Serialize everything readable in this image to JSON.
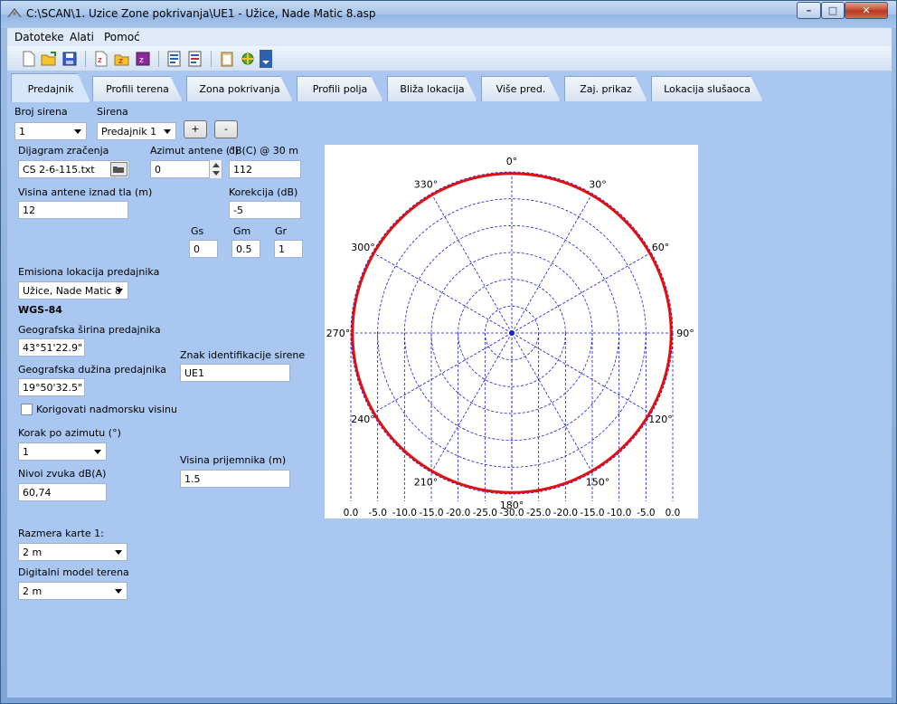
{
  "window": {
    "title": "C:\\SCAN\\1. Uzice Zone pokrivanja\\UE1 - Užice, Nade Matic 8.asp",
    "min_label": "–",
    "max_label": "□",
    "close_label": "✕"
  },
  "menu": [
    "Datoteke",
    "Alati",
    "Pomoć"
  ],
  "toolbar": {
    "icons": [
      "new-icon",
      "open-icon",
      "save-icon",
      "new-z-icon",
      "open-z-icon",
      "save-z-icon",
      "word-icon",
      "word-export-icon",
      "clipboard-icon",
      "tools-icon",
      "more-icon"
    ]
  },
  "tabs": [
    "Predajnik",
    "Profili terena",
    "Zona pokrivanja",
    "Profili polja",
    "Bliža lokacija",
    "Više pred.",
    "Zaj. prikaz",
    "Lokacija slušaoca"
  ],
  "form": {
    "broj_sirena_label": "Broj sirena",
    "broj_sirena_value": "1",
    "sirena_label": "Sirena",
    "sirena_value": "Predajnik 1",
    "plus_label": "+",
    "minus_label": "-",
    "dijagram_label": "Dijagram zračenja",
    "dijagram_value": "CS 2-6-115.txt",
    "azimut_label": "Azimut antene (°)",
    "azimut_value": "0",
    "db_label": "dB(C) @ 30 m",
    "db_value": "112",
    "visina_antene_label": "Visina antene iznad tla (m)",
    "visina_antene_value": "12",
    "korekcija_label": "Korekcija (dB)",
    "korekcija_value": "-5",
    "gs_label": "Gs",
    "gs_value": "0",
    "gm_label": "Gm",
    "gm_value": "0.5",
    "gr_label": "Gr",
    "gr_value": "1",
    "emisiona_label": "Emisiona lokacija predajnika",
    "emisiona_value": "Užice, Nade Matic 8",
    "wgs_label": "WGS-84",
    "sirina_label": "Geografska širina predajnika",
    "sirina_value": "43°51'22.9\"",
    "duzina_label": "Geografska dužina predajnika",
    "duzina_value": "19°50'32.5\"",
    "znak_label": "Znak identifikacije sirene",
    "znak_value": "UE1",
    "korigovati_label": "Korigovati nadmorsku visinu",
    "korak_label": "Korak po azimutu (°)",
    "korak_value": "1",
    "nivoi_label": "Nivoi zvuka dB(A)",
    "nivoi_value": "60,74",
    "visina_prijemnika_label": "Visina prijemnika (m)",
    "visina_prijemnika_value": "1.5",
    "razmera_label": "Razmera karte 1:",
    "razmera_value": "2 m",
    "dmt_label": "Digitalni model terena",
    "dmt_value": "2 m"
  },
  "chart_data": {
    "type": "polar",
    "angle_labels": [
      "0°",
      "30°",
      "60°",
      "90°",
      "120°",
      "150°",
      "180°",
      "210°",
      "240°",
      "270°",
      "300°",
      "330°"
    ],
    "radial_axis_labels": [
      "0.0",
      "-5.0",
      "-10.0",
      "-15.0",
      "-20.0",
      "-25.0",
      "-30.0",
      "-25.0",
      "-20.0",
      "-15.0",
      "-10.0",
      "-5.0",
      "0.0"
    ],
    "rlim": [
      -30,
      0
    ],
    "ring_step_db": 5,
    "spoke_step_deg": 30,
    "grid": true,
    "series": [
      {
        "values_db": "approximately -0.3 dB at all azimuths (near-omnidirectional)",
        "constant_db": -0.3,
        "color": "#e01010"
      }
    ],
    "grid_color": "#1a1adb"
  }
}
